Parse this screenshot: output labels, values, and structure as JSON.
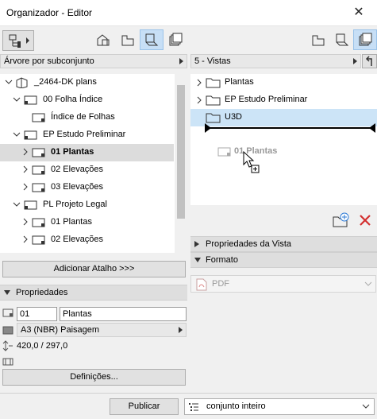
{
  "window": {
    "title": "Organizador - Editor",
    "close_glyph": "✕"
  },
  "left": {
    "dropdown": "Árvore por subconjunto",
    "tree": [
      {
        "label": "_2464-DK plans",
        "level": 0,
        "expanded": true,
        "icon": "project-map-icon"
      },
      {
        "label": "00 Folha Índice",
        "level": 1,
        "expanded": true,
        "icon": "subset-icon"
      },
      {
        "label": "Índice de Folhas",
        "level": 2,
        "icon": "layout-icon"
      },
      {
        "label": "EP Estudo Preliminar",
        "level": 1,
        "expanded": true,
        "icon": "subset-icon"
      },
      {
        "label": "01 Plantas",
        "level": 2,
        "collapsed": true,
        "icon": "layout-icon",
        "selected": true
      },
      {
        "label": "02 Elevações",
        "level": 2,
        "collapsed": true,
        "icon": "layout-icon"
      },
      {
        "label": "03 Elevações",
        "level": 2,
        "collapsed": true,
        "icon": "layout-icon"
      },
      {
        "label": "PL Projeto Legal",
        "level": 1,
        "expanded": true,
        "icon": "subset-icon"
      },
      {
        "label": "01 Plantas",
        "level": 2,
        "collapsed": true,
        "icon": "layout-icon"
      },
      {
        "label": "02 Elevações",
        "level": 2,
        "collapsed": true,
        "icon": "layout-icon"
      }
    ],
    "add_shortcut_button": "Adicionar Atalho >>>",
    "properties_header": "Propriedades",
    "properties": {
      "number": "01",
      "name": "Plantas",
      "format": "A3 (NBR) Paisagem",
      "size": "420,0 / 297,0"
    },
    "definitions_button": "Definições..."
  },
  "right": {
    "dropdown": "5 - Vistas",
    "folders": [
      {
        "label": "Plantas",
        "icon": "folder-icon",
        "chevron": true
      },
      {
        "label": "EP Estudo Preliminar",
        "icon": "folder-icon",
        "chevron": true
      },
      {
        "label": "U3D",
        "icon": "folder-icon",
        "selected": true
      }
    ],
    "drag_ghost": "01 Plantas",
    "view_properties_header": "Propriedades da Vista",
    "format_header": "Formato",
    "format_value": "PDF"
  },
  "bottom": {
    "publish_button": "Publicar",
    "set_value": "conjunto inteiro"
  },
  "colors": {
    "selection_blue": "#cce4f7",
    "toolbar_selected": "#c7dff6",
    "delete_red": "#d32f2f",
    "accent_blue": "#2e7bd6"
  }
}
